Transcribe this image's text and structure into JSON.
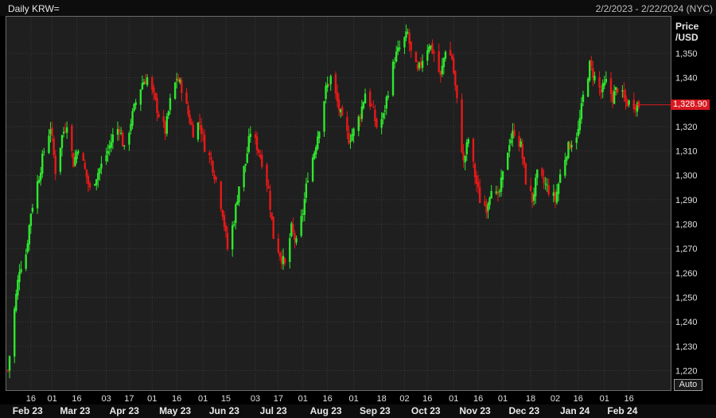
{
  "window": {
    "title": "Daily KRW=",
    "date_range": "2/2/2023 - 2/22/2024 (NYC)",
    "auto_label": "Auto"
  },
  "colors": {
    "background": "#1f1f1f",
    "grid": "#3a3a3a",
    "up": "#2ee82e",
    "down": "#e81818",
    "last_price_tag": "#d71920"
  },
  "chart_data": {
    "type": "candlestick",
    "ylabel": "Price\n/USD",
    "ylim": [
      1212,
      1365
    ],
    "grid": true,
    "last_price": "1,328.90",
    "last_price_value": 1328.9,
    "y_ticks": [
      {
        "value": 1220,
        "label": "1,220"
      },
      {
        "value": 1230,
        "label": "1,230"
      },
      {
        "value": 1240,
        "label": "1,240"
      },
      {
        "value": 1250,
        "label": "1,250"
      },
      {
        "value": 1260,
        "label": "1,260"
      },
      {
        "value": 1270,
        "label": "1,270"
      },
      {
        "value": 1280,
        "label": "1,280"
      },
      {
        "value": 1290,
        "label": "1,290"
      },
      {
        "value": 1300,
        "label": "1,300"
      },
      {
        "value": 1310,
        "label": "1,310"
      },
      {
        "value": 1320,
        "label": "1,320"
      },
      {
        "value": 1330,
        "label": "1,330"
      },
      {
        "value": 1340,
        "label": "1,340"
      },
      {
        "value": 1350,
        "label": "1,350"
      }
    ],
    "x_ticks": [
      {
        "date": "2023-02-16",
        "label": "16"
      },
      {
        "date": "2023-03-01",
        "label": "01"
      },
      {
        "date": "2023-03-16",
        "label": "16"
      },
      {
        "date": "2023-04-03",
        "label": "03"
      },
      {
        "date": "2023-04-17",
        "label": "17"
      },
      {
        "date": "2023-05-01",
        "label": "01"
      },
      {
        "date": "2023-05-16",
        "label": "16"
      },
      {
        "date": "2023-06-01",
        "label": "01"
      },
      {
        "date": "2023-06-15",
        "label": "15"
      },
      {
        "date": "2023-07-03",
        "label": "03"
      },
      {
        "date": "2023-07-17",
        "label": "17"
      },
      {
        "date": "2023-08-01",
        "label": "01"
      },
      {
        "date": "2023-08-16",
        "label": "16"
      },
      {
        "date": "2023-09-01",
        "label": "01"
      },
      {
        "date": "2023-09-18",
        "label": "18"
      },
      {
        "date": "2023-10-02",
        "label": "02"
      },
      {
        "date": "2023-10-16",
        "label": "16"
      },
      {
        "date": "2023-11-01",
        "label": "01"
      },
      {
        "date": "2023-11-16",
        "label": "16"
      },
      {
        "date": "2023-12-01",
        "label": "01"
      },
      {
        "date": "2023-12-18",
        "label": "18"
      },
      {
        "date": "2024-01-02",
        "label": "02"
      },
      {
        "date": "2024-01-16",
        "label": "16"
      },
      {
        "date": "2024-02-01",
        "label": "01"
      },
      {
        "date": "2024-02-16",
        "label": "16"
      }
    ],
    "month_labels": [
      {
        "date": "2023-02-14",
        "label": "Feb 23"
      },
      {
        "date": "2023-03-15",
        "label": "Mar 23"
      },
      {
        "date": "2023-04-14",
        "label": "Apr 23"
      },
      {
        "date": "2023-05-15",
        "label": "May 23"
      },
      {
        "date": "2023-06-14",
        "label": "Jun 23"
      },
      {
        "date": "2023-07-14",
        "label": "Jul 23"
      },
      {
        "date": "2023-08-15",
        "label": "Aug 23"
      },
      {
        "date": "2023-09-14",
        "label": "Sep 23"
      },
      {
        "date": "2023-10-15",
        "label": "Oct 23"
      },
      {
        "date": "2023-11-14",
        "label": "Nov 23"
      },
      {
        "date": "2023-12-14",
        "label": "Dec 23"
      },
      {
        "date": "2024-01-14",
        "label": "Jan 24"
      },
      {
        "date": "2024-02-12",
        "label": "Feb 24"
      }
    ],
    "date_range": [
      "2023-02-02",
      "2024-02-22"
    ],
    "path": [
      [
        "2023-02-02",
        1220
      ],
      [
        "2023-02-06",
        1245
      ],
      [
        "2023-02-09",
        1262
      ],
      [
        "2023-02-13",
        1268
      ],
      [
        "2023-02-16",
        1285
      ],
      [
        "2023-02-21",
        1300
      ],
      [
        "2023-02-24",
        1310
      ],
      [
        "2023-02-28",
        1320
      ],
      [
        "2023-03-03",
        1302
      ],
      [
        "2023-03-07",
        1316
      ],
      [
        "2023-03-10",
        1322
      ],
      [
        "2023-03-14",
        1305
      ],
      [
        "2023-03-17",
        1312
      ],
      [
        "2023-03-21",
        1302
      ],
      [
        "2023-03-24",
        1294
      ],
      [
        "2023-03-28",
        1300
      ],
      [
        "2023-03-31",
        1304
      ],
      [
        "2023-04-04",
        1310
      ],
      [
        "2023-04-07",
        1316
      ],
      [
        "2023-04-11",
        1320
      ],
      [
        "2023-04-14",
        1310
      ],
      [
        "2023-04-18",
        1322
      ],
      [
        "2023-04-21",
        1330
      ],
      [
        "2023-04-25",
        1338
      ],
      [
        "2023-04-28",
        1340
      ],
      [
        "2023-05-02",
        1332
      ],
      [
        "2023-05-05",
        1325
      ],
      [
        "2023-05-09",
        1318
      ],
      [
        "2023-05-12",
        1330
      ],
      [
        "2023-05-16",
        1340
      ],
      [
        "2023-05-19",
        1336
      ],
      [
        "2023-05-23",
        1325
      ],
      [
        "2023-05-26",
        1318
      ],
      [
        "2023-05-30",
        1322
      ],
      [
        "2023-06-02",
        1312
      ],
      [
        "2023-06-06",
        1306
      ],
      [
        "2023-06-09",
        1298
      ],
      [
        "2023-06-13",
        1285
      ],
      [
        "2023-06-16",
        1270
      ],
      [
        "2023-06-20",
        1282
      ],
      [
        "2023-06-23",
        1296
      ],
      [
        "2023-06-27",
        1305
      ],
      [
        "2023-06-30",
        1318
      ],
      [
        "2023-07-04",
        1312
      ],
      [
        "2023-07-07",
        1306
      ],
      [
        "2023-07-11",
        1294
      ],
      [
        "2023-07-14",
        1275
      ],
      [
        "2023-07-18",
        1268
      ],
      [
        "2023-07-21",
        1263
      ],
      [
        "2023-07-25",
        1278
      ],
      [
        "2023-07-28",
        1272
      ],
      [
        "2023-08-01",
        1285
      ],
      [
        "2023-08-04",
        1300
      ],
      [
        "2023-08-08",
        1310
      ],
      [
        "2023-08-11",
        1320
      ],
      [
        "2023-08-15",
        1335
      ],
      [
        "2023-08-18",
        1340
      ],
      [
        "2023-08-22",
        1330
      ],
      [
        "2023-08-25",
        1322
      ],
      [
        "2023-08-29",
        1315
      ],
      [
        "2023-09-01",
        1318
      ],
      [
        "2023-09-05",
        1325
      ],
      [
        "2023-09-08",
        1334
      ],
      [
        "2023-09-12",
        1328
      ],
      [
        "2023-09-15",
        1320
      ],
      [
        "2023-09-19",
        1324
      ],
      [
        "2023-09-22",
        1335
      ],
      [
        "2023-09-26",
        1348
      ],
      [
        "2023-09-29",
        1352
      ],
      [
        "2023-10-04",
        1358
      ],
      [
        "2023-10-06",
        1350
      ],
      [
        "2023-10-10",
        1342
      ],
      [
        "2023-10-13",
        1348
      ],
      [
        "2023-10-17",
        1354
      ],
      [
        "2023-10-20",
        1350
      ],
      [
        "2023-10-24",
        1340
      ],
      [
        "2023-10-27",
        1352
      ],
      [
        "2023-10-31",
        1348
      ],
      [
        "2023-11-03",
        1330
      ],
      [
        "2023-11-07",
        1305
      ],
      [
        "2023-11-10",
        1315
      ],
      [
        "2023-11-14",
        1300
      ],
      [
        "2023-11-17",
        1290
      ],
      [
        "2023-11-21",
        1287
      ],
      [
        "2023-11-24",
        1296
      ],
      [
        "2023-11-28",
        1290
      ],
      [
        "2023-12-01",
        1300
      ],
      [
        "2023-12-05",
        1314
      ],
      [
        "2023-12-08",
        1318
      ],
      [
        "2023-12-12",
        1312
      ],
      [
        "2023-12-15",
        1298
      ],
      [
        "2023-12-19",
        1290
      ],
      [
        "2023-12-22",
        1300
      ],
      [
        "2023-12-27",
        1296
      ],
      [
        "2024-01-02",
        1290
      ],
      [
        "2024-01-05",
        1300
      ],
      [
        "2024-01-09",
        1310
      ],
      [
        "2024-01-12",
        1314
      ],
      [
        "2024-01-16",
        1318
      ],
      [
        "2024-01-19",
        1332
      ],
      [
        "2024-01-23",
        1345
      ],
      [
        "2024-01-26",
        1340
      ],
      [
        "2024-01-30",
        1334
      ],
      [
        "2024-02-02",
        1338
      ],
      [
        "2024-02-06",
        1332
      ],
      [
        "2024-02-09",
        1336
      ],
      [
        "2024-02-14",
        1330
      ],
      [
        "2024-02-22",
        1328.9
      ]
    ]
  }
}
